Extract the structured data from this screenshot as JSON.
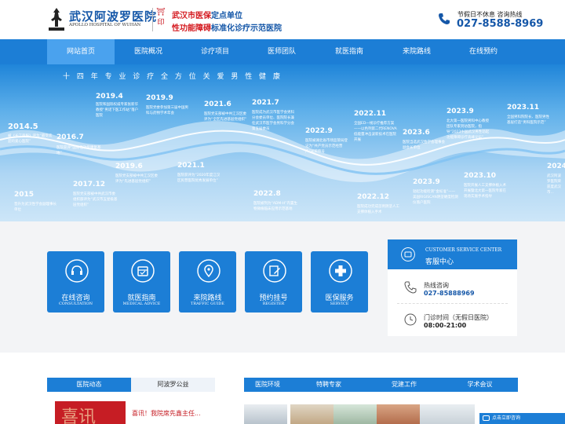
{
  "header": {
    "logo_cn": "武汉阿波罗医院",
    "logo_en": "APOLLO HOSPITAL OF WUHAN",
    "tagline_1_a": "武汉市医保",
    "tagline_1_b": "定点单位",
    "tagline_2_a": "性功能障碍",
    "tagline_2_b": "标准化诊疗示范医院",
    "hotline_label": "节假日不休息 咨询热线",
    "hotline_number": "027-8588-8969"
  },
  "nav": [
    "网站首页",
    "医院概况",
    "诊疗项目",
    "医师团队",
    "就医指南",
    "来院路线",
    "在线预约"
  ],
  "banner": {
    "title": "十 四 年 专 业 诊 疗 全 方 位 关 爱 男 性 健 康",
    "milestones": [
      {
        "year": "2014.5",
        "desc": "被《长江商报》评为“最受欢迎的爱心医院”"
      },
      {
        "year": "2015",
        "desc": "晋升为武汉性学会副理事长单位"
      },
      {
        "year": "2016.7",
        "desc": "医院获评“国际性功能康复基地”"
      },
      {
        "year": "2017.12",
        "desc": "医院党支部被中共武汉市委组织部评为“武汉市五星级基层党组织”"
      },
      {
        "year": "2019.4",
        "desc": "医院和国际权威专家张新华教授“男诺下医工作站”落户医院"
      },
      {
        "year": "2019.6",
        "desc": "医院党支部被中共江汉区委评为“先进基层党组织”"
      },
      {
        "year": "2019.9",
        "desc": "医院党委参加第三届中国男科与药物学术年会"
      },
      {
        "year": "2021.1",
        "desc": "医院获评为“2020年度江汉区民营医院优秀发展单位”"
      },
      {
        "year": "2021.6",
        "desc": "医院党支部被中共江汉区委评为“全区先进基层党组织”"
      },
      {
        "year": "2021.7",
        "desc": "医院成为武汉市医学会男科分会委员单位、医院院长兼任武汉市医学会男科学分会第五届委员"
      },
      {
        "year": "2022.8",
        "desc": "医院被列为“ADM-H”内置生物微植临床应用示范基地"
      },
      {
        "year": "2022.9",
        "desc": "医院被湖北省市场监管局登记为“共产党员示范经营户”光荣称号"
      },
      {
        "year": "2022.11",
        "desc": "全国ED一线诊疗推荐方案——以色列第二代RENOVA低能量冲击波新技术在医院开展"
      },
      {
        "year": "2022.12",
        "desc": "医院成功完成首例阴茎人工支撑体植入手术"
      },
      {
        "year": "2023.6",
        "desc": "医院当选武汉性学会理事会副会长单位"
      },
      {
        "year": "2023.9",
        "desc": "北大第一医院男科中心教授团队专家到访医院，指导“2023中国武汉男性勃起功能障碍诊疗高峰论坛”"
      },
      {
        "year": "2023.9",
        "desc": "勃起功能检测“金标准”——美国RIGISCAN阴茎硬度检测仪落户医院"
      },
      {
        "year": "2023.10",
        "desc": "医院开展人工支撑体植入术开展暨北大第一医院专家在现场实施手术指导"
      },
      {
        "year": "2023.11",
        "desc": "全国男科院院长、医院男性基层打造“男科医院示范”"
      },
      {
        "year": "2024.",
        "desc": "武汉阿波罗医院荣获度武汉市..."
      }
    ]
  },
  "services": [
    {
      "cn": "在线咨询",
      "en": "CONSULTATION",
      "icon": "headset-icon"
    },
    {
      "cn": "就医指南",
      "en": "MEDICAL ADVICE",
      "icon": "calendar-icon"
    },
    {
      "cn": "来院路线",
      "en": "TRAFFIC GUIDE",
      "icon": "location-pin-icon"
    },
    {
      "cn": "预约挂号",
      "en": "REGISTER",
      "icon": "edit-icon"
    },
    {
      "cn": "医保服务",
      "en": "SERVICE",
      "icon": "plus-icon"
    }
  ],
  "customer_service": {
    "title_en": "CUSTOMER SERVICE CENTER",
    "title_cn": "客服中心",
    "phone_label": "热线咨询",
    "phone_value": "027-85888969",
    "hours_label": "门诊时间（无假日医院）",
    "hours_value": "08:00-21:00"
  },
  "tabs_left": [
    "医院动态",
    "阿波罗公益"
  ],
  "tabs_right": [
    "医院环境",
    "特聘专家",
    "党建工作",
    "学术会议"
  ],
  "news": {
    "headline": "喜讯！我院席先鑫主任...",
    "image_text": "喜讯"
  },
  "consult_button": "点击立即咨询",
  "colors": {
    "primary": "#1c7ed6",
    "accent_red": "#d4191f",
    "brand_blue": "#1557a8"
  }
}
